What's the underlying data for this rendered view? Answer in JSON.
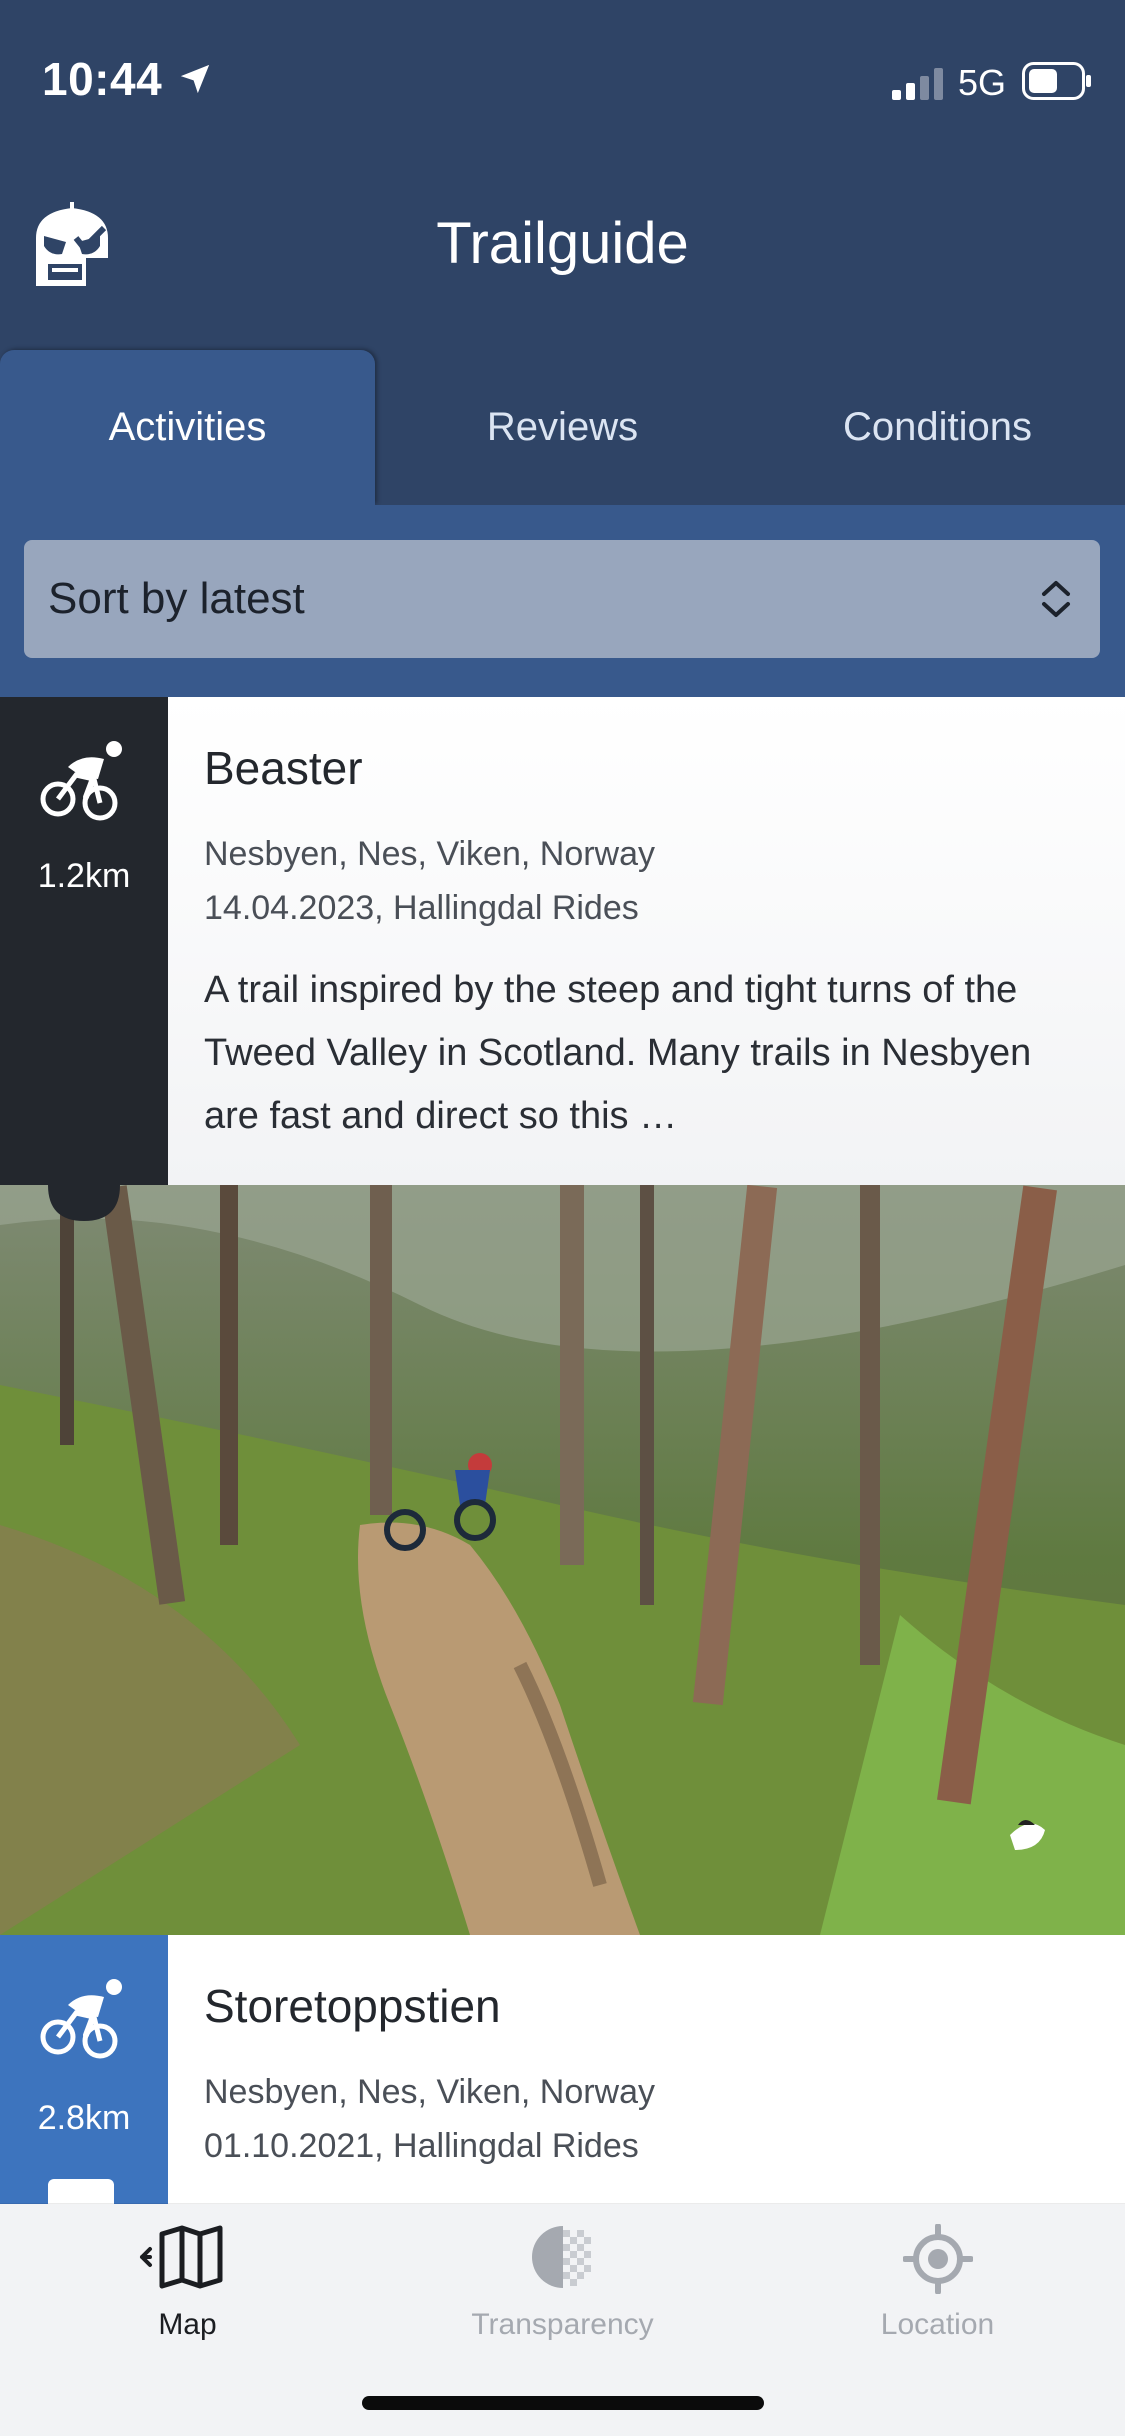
{
  "status_bar": {
    "time": "10:44",
    "network": "5G",
    "icons": [
      "location-arrow-icon",
      "signal-icon",
      "battery-icon"
    ]
  },
  "app": {
    "title": "Trailguide",
    "logo_icon": "trailguide-logo-icon"
  },
  "tabs": [
    {
      "label": "Activities",
      "active": true
    },
    {
      "label": "Reviews",
      "active": false
    },
    {
      "label": "Conditions",
      "active": false
    }
  ],
  "sort": {
    "selected": "Sort by latest",
    "icon": "chevron-up-down-icon"
  },
  "activities": [
    {
      "title": "Beaster",
      "distance": "1.2km",
      "location": "Nesbyen, Nes, Viken, Norway",
      "date_source": "14.04.2023, Hallingdal Rides",
      "description": "A trail inspired by the steep and tight turns of the Tweed Valley in Scotland. Many trails in Nesbyen are fast and direct so this …",
      "side_color": "#23272d",
      "icon": "mountain-bike-icon"
    },
    {
      "title": "Storetoppstien",
      "distance": "2.8km",
      "location": "Nesbyen, Nes, Viken, Norway",
      "date_source": "01.10.2021, Hallingdal Rides",
      "side_color": "#3d74be",
      "icon": "mountain-bike-icon"
    }
  ],
  "toolbar": [
    {
      "label": "Map",
      "icon": "map-icon",
      "enabled": true
    },
    {
      "label": "Transparency",
      "icon": "transparency-icon",
      "enabled": false
    },
    {
      "label": "Location",
      "icon": "location-target-icon",
      "enabled": false
    }
  ],
  "colors": {
    "header": "#2f4466",
    "tab_active": "#38598c",
    "sort_bg": "#98a6bd",
    "toolbar_bg": "#f2f3f5"
  }
}
